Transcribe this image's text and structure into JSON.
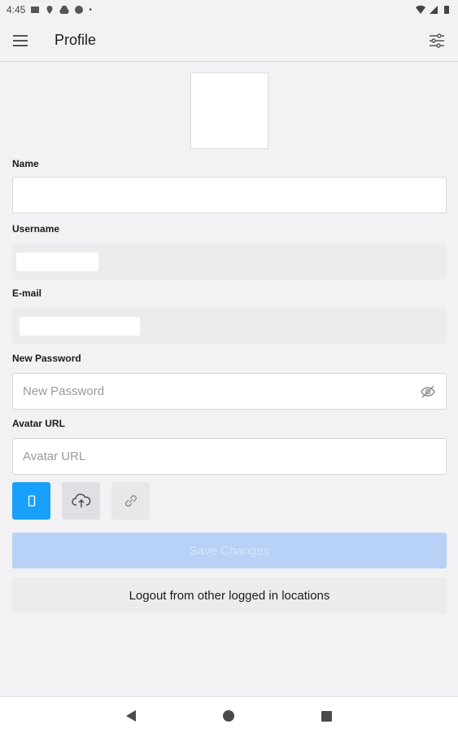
{
  "status_bar": {
    "time": "4:45"
  },
  "app_bar": {
    "title": "Profile",
    "menu_icon": "hamburger-menu-icon",
    "filter_icon": "tune-sliders-icon"
  },
  "form": {
    "name": {
      "label": "Name",
      "value": "",
      "placeholder": ""
    },
    "username": {
      "label": "Username"
    },
    "email": {
      "label": "E-mail"
    },
    "new_password": {
      "label": "New Password",
      "placeholder": "New Password"
    },
    "avatar_url": {
      "label": "Avatar URL",
      "placeholder": "Avatar URL"
    }
  },
  "avatar_source_tabs": [
    {
      "icon": "phone-icon",
      "selected": true
    },
    {
      "icon": "cloud-upload-icon",
      "selected": false
    },
    {
      "icon": "link-icon",
      "selected": false
    }
  ],
  "actions": {
    "save_label": "Save Changes",
    "logout_label": "Logout from other logged in locations"
  },
  "colors": {
    "accent": "#18a0fb",
    "save_disabled_bg": "#b7d1f7",
    "background": "#f2f2f4"
  }
}
